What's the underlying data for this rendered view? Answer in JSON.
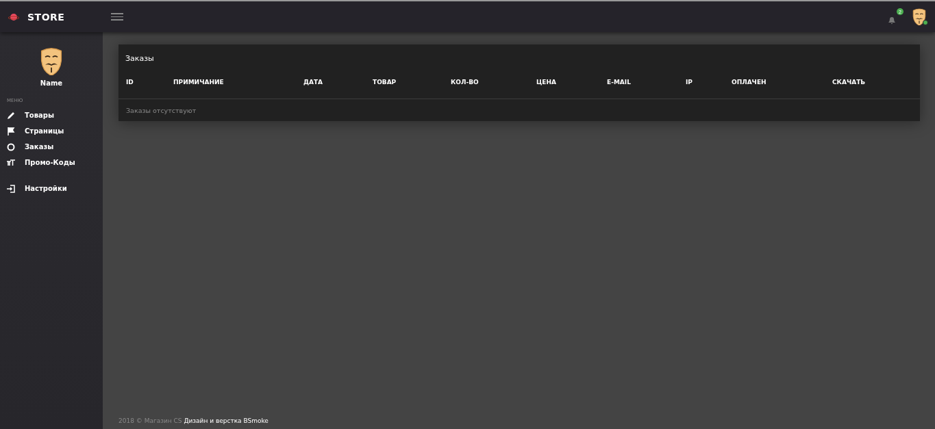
{
  "topbar": {
    "logo_text": "STORE",
    "notification_count": "2"
  },
  "sidebar": {
    "user_name": "Name",
    "section_label": "МЕНЮ",
    "items": [
      {
        "label": "Товары"
      },
      {
        "label": "Страницы"
      },
      {
        "label": "Заказы"
      },
      {
        "label": "Промо-Коды"
      }
    ],
    "bottom_items": [
      {
        "label": "Настройки"
      }
    ]
  },
  "card": {
    "title": "Заказы",
    "table": {
      "columns": [
        "ID",
        "ПРИМИЧАНИЕ",
        "ДАТА",
        "ТОВАР",
        "КОЛ-ВО",
        "ЦЕНА",
        "E-MAIL",
        "IP",
        "ОПЛАЧЕН",
        "СКАЧАТЬ"
      ],
      "empty_message": "Заказы отсутствуют"
    }
  },
  "footer": {
    "text": "2018 © Магазин CS",
    "link": "Дизайн и верстка BSmoke"
  }
}
